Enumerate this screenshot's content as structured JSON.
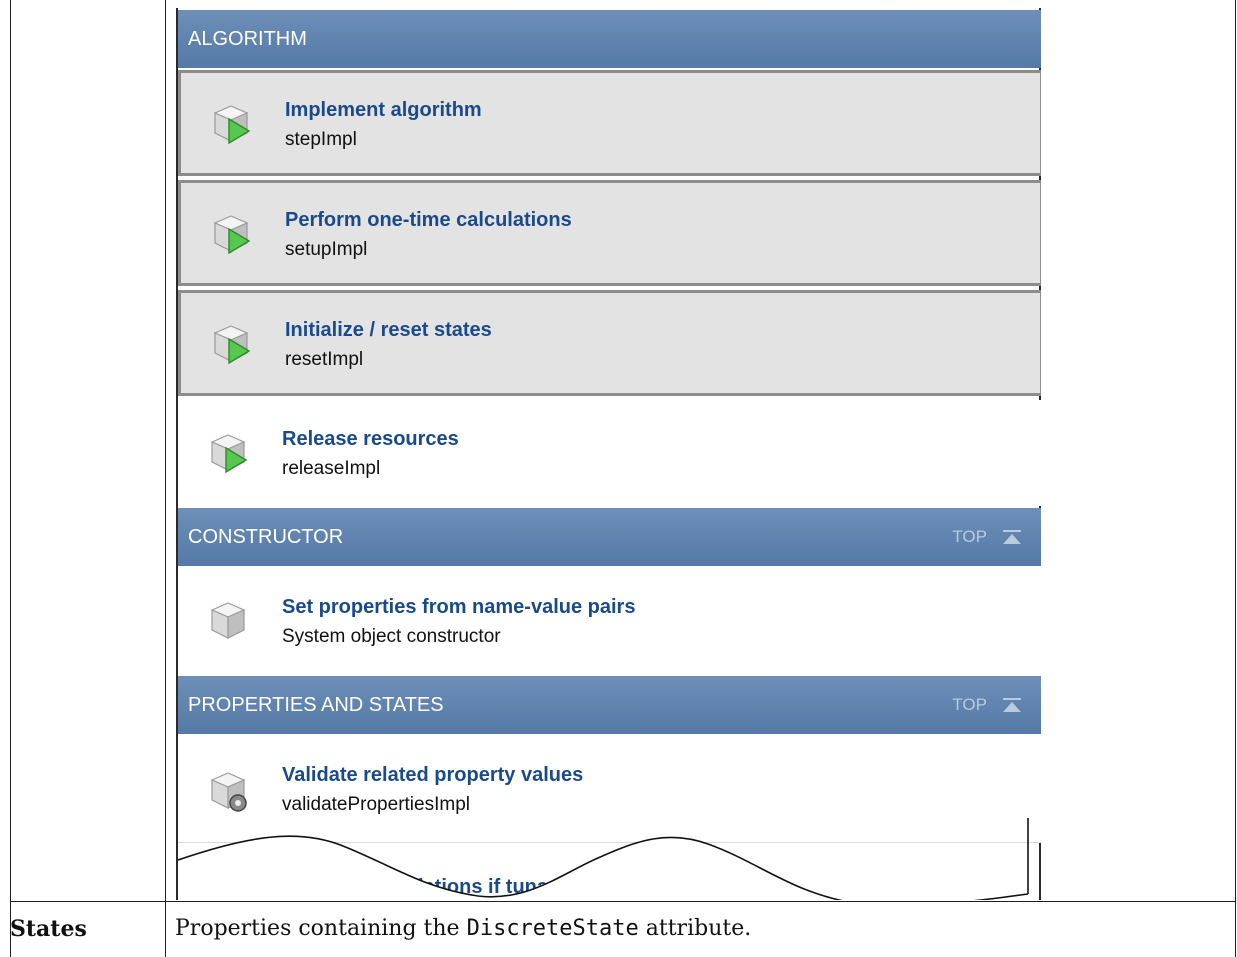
{
  "sections": {
    "algorithm": {
      "header": "ALGORITHM",
      "items": [
        {
          "title": "Implement algorithm",
          "method": "stepImpl"
        },
        {
          "title": "Perform one-time calculations",
          "method": "setupImpl"
        },
        {
          "title": "Initialize / reset states",
          "method": "resetImpl"
        },
        {
          "title": "Release resources",
          "method": "releaseImpl"
        }
      ]
    },
    "constructor": {
      "header": "CONSTRUCTOR",
      "top_label": "TOP",
      "items": [
        {
          "title": "Set properties from name-value pairs",
          "method": "System object constructor"
        }
      ]
    },
    "properties_and_states": {
      "header": "PROPERTIES AND STATES",
      "top_label": "TOP",
      "items": [
        {
          "title": "Validate related property values",
          "method": "validatePropertiesImpl"
        }
      ],
      "cut_off_text": "lations if tuna"
    }
  },
  "table_row": {
    "label": "States",
    "desc_before": "Properties containing the ",
    "desc_code": "DiscreteState",
    "desc_after": " attribute."
  },
  "colors": {
    "header_bg": "#5f83af",
    "title_text": "#1a4a8a",
    "highlight_bg": "#e3e3e3",
    "play_green": "#4cc24c"
  },
  "icons": {
    "play_cube": "cube-play-icon",
    "cube": "cube-icon",
    "gear_cube": "cube-gear-icon",
    "top_arrow": "arrow-to-top-icon"
  }
}
